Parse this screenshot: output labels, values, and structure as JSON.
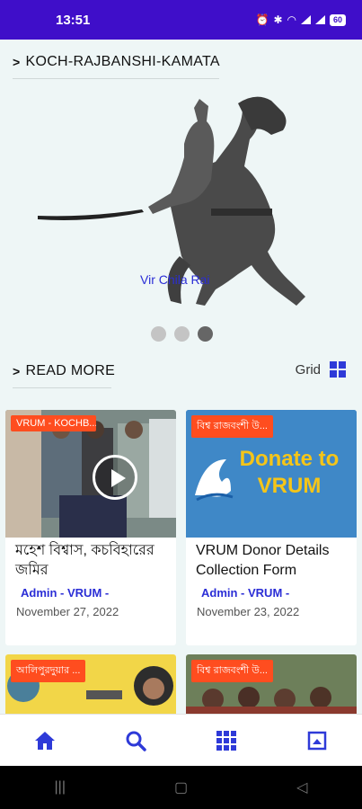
{
  "status": {
    "time": "13:51",
    "battery": "60"
  },
  "section1": {
    "title": "KOCH-RAJBANSHI-KAMATA",
    "slide_caption": "Vir Chila Rai",
    "dots": 3,
    "active_dot": 3
  },
  "section2": {
    "title": "READ MORE",
    "view_toggle": "Grid"
  },
  "cards": [
    {
      "badge": "VRUM - KOCHB...",
      "title": "মহেশ বিশ্বাস, কচবিহারের জমির",
      "author": "Admin - VRUM -",
      "date": "November 27, 2022",
      "has_video": true
    },
    {
      "badge": "বিশ্ব রাজবংশী উ...",
      "title": "VRUM Donor Details Collection Form",
      "author": "Admin - VRUM -",
      "date": "November 23, 2022",
      "thumb_text": "Donate to VRUM"
    },
    {
      "badge": "আলিপুরদুয়ার ..."
    },
    {
      "badge": "বিশ্ব রাজবংশী উ..."
    }
  ],
  "nav": {
    "items": [
      "home-icon",
      "search-icon",
      "apps-grid-icon",
      "image-icon"
    ],
    "accent": "#2e3ad8"
  }
}
